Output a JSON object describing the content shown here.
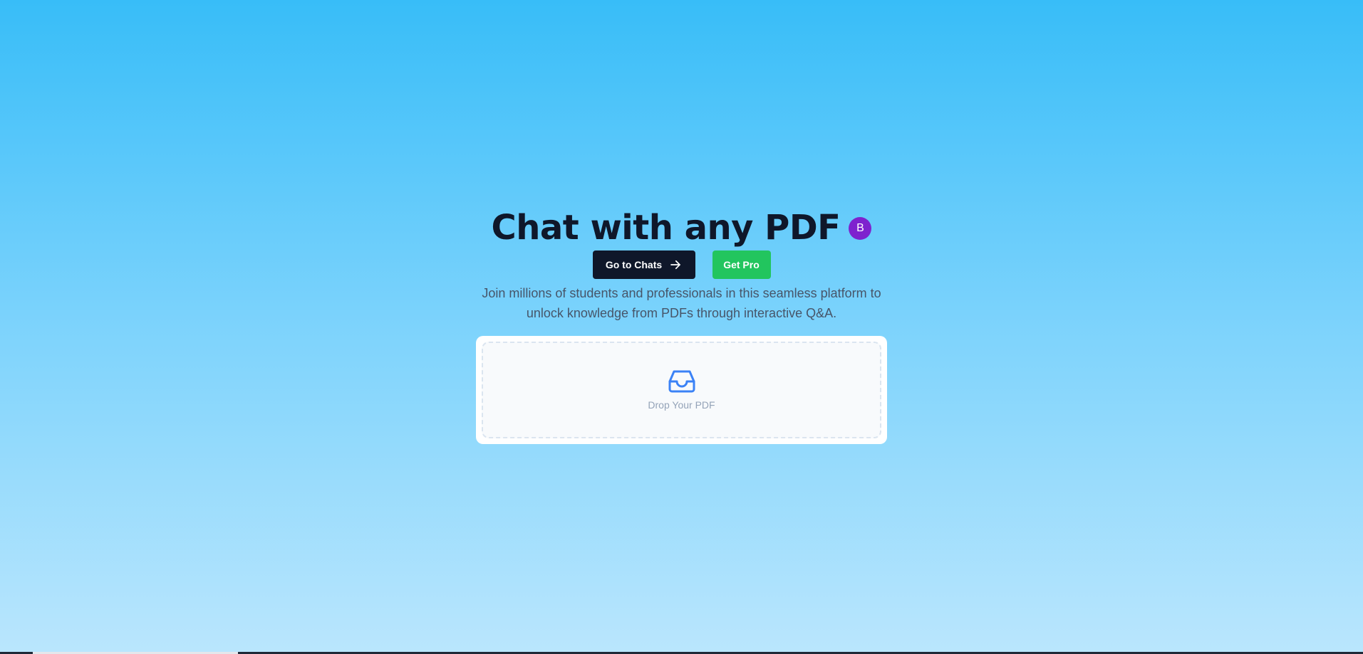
{
  "hero": {
    "title": "Chat with any PDF",
    "avatar_initial": "B",
    "subtitle": "Join millions of students and professionals in this seamless platform to unlock knowledge from PDFs through interactive Q&A."
  },
  "buttons": {
    "go_to_chats_label": "Go to Chats",
    "go_to_chats_icon": "arrow-right-icon",
    "get_pro_label": "Get Pro"
  },
  "upload": {
    "icon": "inbox-icon",
    "label": "Drop Your PDF"
  },
  "colors": {
    "background_top": "#38bdf8",
    "background_bottom": "#bae6fd",
    "title": "#0f172a",
    "avatar": "#7e22ce",
    "primary_button": "#0f172a",
    "pro_button": "#22c55e",
    "icon_accent": "#3b82f6"
  }
}
